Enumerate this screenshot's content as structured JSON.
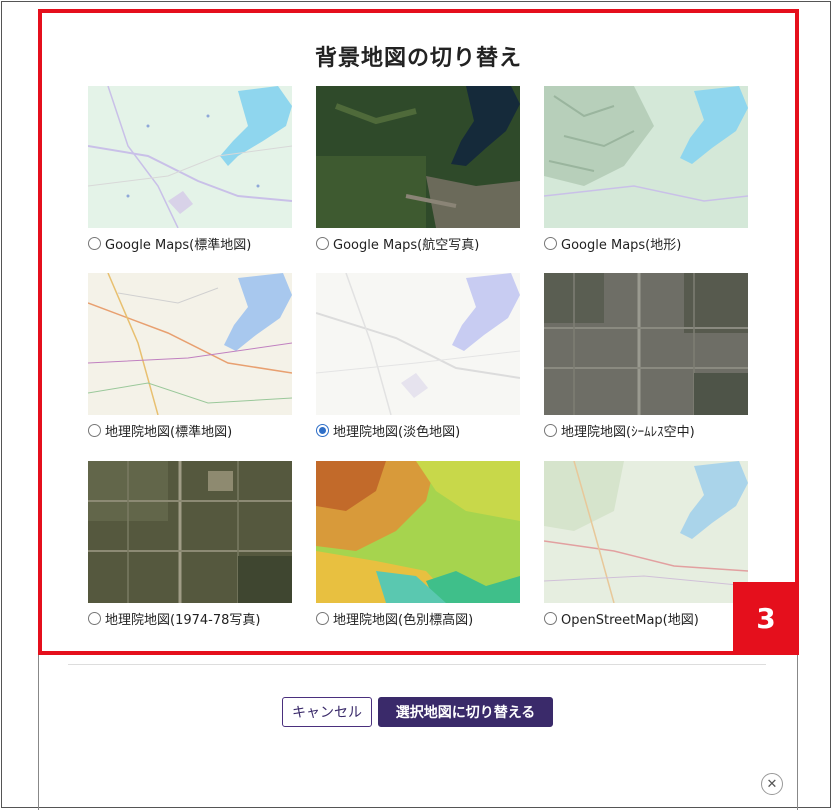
{
  "dialog": {
    "title": "背景地図の切り替え",
    "step_badge": "3",
    "options": [
      {
        "label": "Google Maps(標準地図)",
        "selected": false,
        "style": "road"
      },
      {
        "label": "Google Maps(航空写真)",
        "selected": false,
        "style": "satellite"
      },
      {
        "label": "Google Maps(地形)",
        "selected": false,
        "style": "terrain"
      },
      {
        "label": "地理院地図(標準地図)",
        "selected": false,
        "style": "gsi-standard"
      },
      {
        "label": "地理院地図(淡色地図)",
        "selected": true,
        "style": "gsi-pale"
      },
      {
        "label": "地理院地図(ｼｰﾑﾚｽ空中)",
        "selected": false,
        "style": "seamless-aerial"
      },
      {
        "label": "地理院地図(1974-78写真)",
        "selected": false,
        "style": "aerial-1970s"
      },
      {
        "label": "地理院地図(色別標高図)",
        "selected": false,
        "style": "relief"
      },
      {
        "label": "OpenStreetMap(地図)",
        "selected": false,
        "style": "osm"
      }
    ],
    "buttons": {
      "cancel_label": "キャンセル",
      "switch_label": "選択地図に切り替える"
    },
    "close_icon": "close-icon",
    "colors": {
      "highlight": "#e50f1c",
      "primary_button": "#3a2a6a",
      "radio_selected": "#2f6fc7"
    }
  }
}
